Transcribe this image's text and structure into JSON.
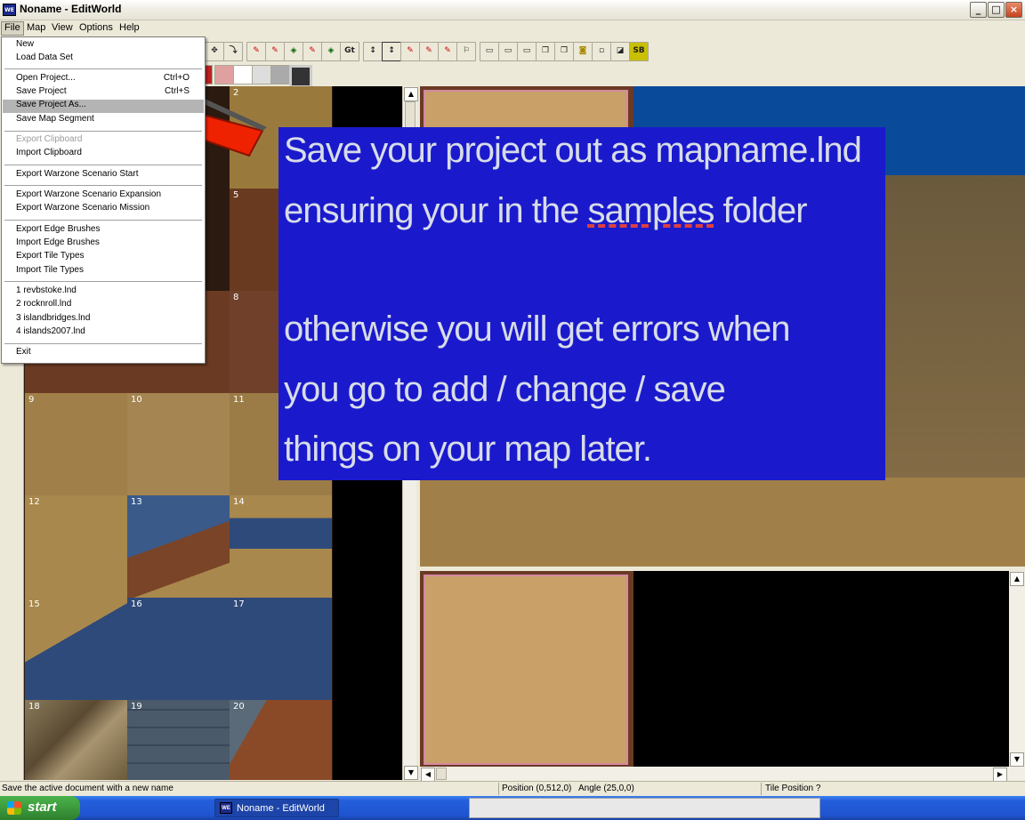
{
  "window": {
    "title": "Noname - EditWorld",
    "app_icon": "WE"
  },
  "menubar": [
    "File",
    "Map",
    "View",
    "Options",
    "Help"
  ],
  "file_menu": {
    "items": [
      {
        "label": "New",
        "shortcut": ""
      },
      {
        "label": "Load Data Set",
        "shortcut": ""
      },
      {
        "label": "Open Project...",
        "shortcut": "Ctrl+O"
      },
      {
        "label": "Save Project",
        "shortcut": "Ctrl+S"
      },
      {
        "label": "Save Project As...",
        "shortcut": ""
      },
      {
        "label": "Save Map Segment",
        "shortcut": ""
      },
      {
        "label": "Export Clipboard",
        "shortcut": ""
      },
      {
        "label": "Import Clipboard",
        "shortcut": ""
      },
      {
        "label": "Export Warzone Scenario Start",
        "shortcut": ""
      },
      {
        "label": "Export Warzone Scenario Expansion",
        "shortcut": ""
      },
      {
        "label": "Export Warzone Scenario Mission",
        "shortcut": ""
      },
      {
        "label": "Export Edge Brushes",
        "shortcut": ""
      },
      {
        "label": "Import Edge Brushes",
        "shortcut": ""
      },
      {
        "label": "Export Tile Types",
        "shortcut": ""
      },
      {
        "label": "Import Tile Types",
        "shortcut": ""
      },
      {
        "label": "1 revbstoke.lnd",
        "shortcut": ""
      },
      {
        "label": "2 rocknroll.lnd",
        "shortcut": ""
      },
      {
        "label": "3 islandbridges.lnd",
        "shortcut": ""
      },
      {
        "label": "4 islands2007.lnd",
        "shortcut": ""
      },
      {
        "label": "Exit",
        "shortcut": ""
      }
    ],
    "highlighted": "Save Project As...",
    "disabled": [
      "Export Clipboard"
    ]
  },
  "toolbar": {
    "gt_label": "Gt",
    "sb_label": "SB"
  },
  "tiles": [
    "2",
    "5",
    "8",
    "9",
    "10",
    "11",
    "12",
    "13",
    "14",
    "15",
    "16",
    "17",
    "18",
    "19",
    "20"
  ],
  "annotation": {
    "line1": "Save your project out as mapname.lnd",
    "line2_prefix": "ensuring your in the ",
    "line2_underlined": "samples",
    "line2_suffix": " folder",
    "line3": "otherwise you will get errors when",
    "line4": "you go to add / change / save",
    "line5": "things on your map later."
  },
  "statusbar": {
    "message": "Save the active document with a new name",
    "position": "Position (0,512,0)",
    "angle": "Angle (25,0,0)",
    "tile_position": "Tile Position ?"
  },
  "taskbar": {
    "start": "start",
    "task": "Noname - EditWorld"
  },
  "colors": {
    "annotation_bg": "#1a1acc",
    "annotation_text": "#d8dce8",
    "view_sky": "#0a4a9a",
    "sand": "#a08048"
  }
}
